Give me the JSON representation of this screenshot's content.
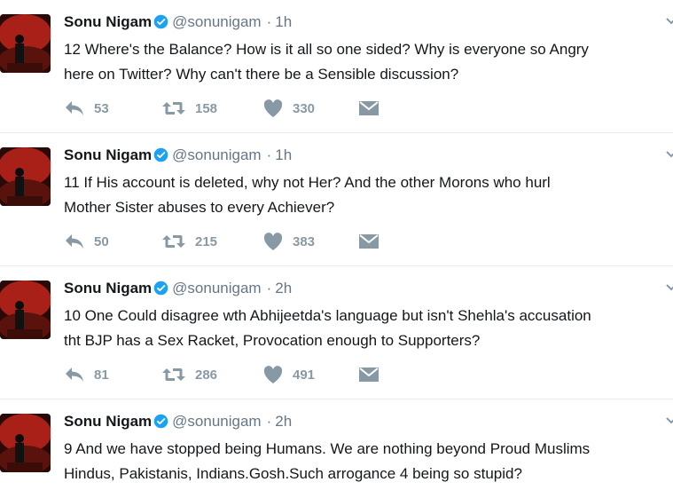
{
  "tweets": [
    {
      "name": "Sonu Nigam",
      "handle": "@sonunigam",
      "separator": "·",
      "time": "1h",
      "lines": [
        "12 Where's the Balance? How is it all so one sided? Why is everyone so Angry",
        "here on Twitter? Why can't there be a Sensible discussion?"
      ],
      "replies": "53",
      "retweets": "158",
      "likes": "330"
    },
    {
      "name": "Sonu Nigam",
      "handle": "@sonunigam",
      "separator": "·",
      "time": "1h",
      "lines": [
        "11 If His account is deleted, why not Her? And the other Morons who hurl",
        "Mother Sister abuses to every Achiever?"
      ],
      "replies": "50",
      "retweets": "215",
      "likes": "383"
    },
    {
      "name": "Sonu Nigam",
      "handle": "@sonunigam",
      "separator": "·",
      "time": "2h",
      "lines": [
        "10 One Could disagree wth Abhijeetda's language but isn't Shehla's accusation",
        "tht BJP has a Sex Racket, Provocation enough to Supporters?"
      ],
      "replies": "81",
      "retweets": "286",
      "likes": "491"
    },
    {
      "name": "Sonu Nigam",
      "handle": "@sonunigam",
      "separator": "·",
      "time": "2h",
      "lines": [
        "9 And we have stopped being Humans. We are nothing beyond Proud Muslims",
        "Hindus, Pakistanis, Indians.Gosh.Such arrogance 4 being so stupid?"
      ],
      "replies": "",
      "retweets": "",
      "likes": ""
    }
  ],
  "icons": {
    "verified": "verified-badge-icon",
    "reply": "reply-arrow-icon",
    "retweet": "retweet-icon",
    "like": "heart-icon",
    "dm": "envelope-icon",
    "caret": "chevron-down-icon"
  },
  "colors": {
    "verified": "#1da1f2",
    "action_icon": "#8899a6",
    "handle": "#657786",
    "text": "#14171a",
    "divider": "#e6ecf0"
  }
}
